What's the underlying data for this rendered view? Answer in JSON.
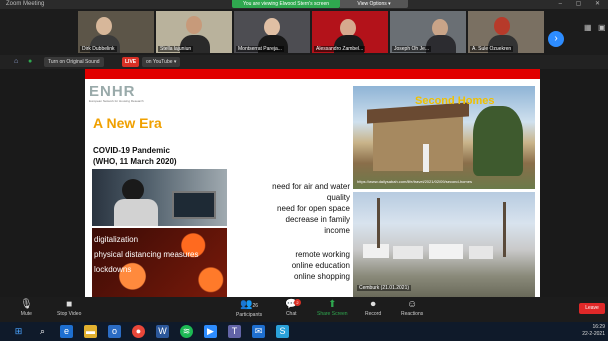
{
  "window": {
    "title": "Zoom Meeting",
    "sharing_banner": "You are viewing Elwood Stern's screen",
    "view_options": "View Options ▾"
  },
  "participants": [
    {
      "name": "Dirk Dubbelink"
    },
    {
      "name": "Stella lajuniun"
    },
    {
      "name": "Montserrat Pareja..."
    },
    {
      "name": "Alessandro Zambel..."
    },
    {
      "name": "Joseph Oh Je..."
    },
    {
      "name": "A. Sule Ozuekren"
    }
  ],
  "subbar": {
    "original_sound": "Turn on Original Sound",
    "live_label": "LIVE",
    "youtube_label": "on YouTube ▾"
  },
  "slide": {
    "logo": "ENHR",
    "logo_sub": "European Network for Housing Research",
    "title": "A New Era",
    "covid_line1": "COVID-19 Pandemic",
    "covid_line2": "(WHO, 11 March 2020)",
    "needs": [
      "need for air and water",
      "quality",
      "need for open space",
      "decrease in family",
      "income"
    ],
    "remote": [
      "remote working",
      "online education",
      "online shopping"
    ],
    "virus_labels": [
      "digitalization",
      "physical distancing measures",
      "lockdowns"
    ],
    "house_title": "Second Homes",
    "house_caption": "https://www.dailysabah.com/life/travel/2021/02/09/second-homes",
    "camp_caption": "Cemburk (21.01.2021)"
  },
  "controls": {
    "mute": "Mute",
    "stop_video": "Stop Video",
    "participants": "Participants",
    "participants_count": "26",
    "chat": "Chat",
    "chat_badge": "2",
    "share_screen": "Share Screen",
    "record": "Record",
    "reactions": "Reactions",
    "leave": "Leave"
  },
  "taskbar": {
    "time": "16:29",
    "date": "22-2-2021"
  }
}
